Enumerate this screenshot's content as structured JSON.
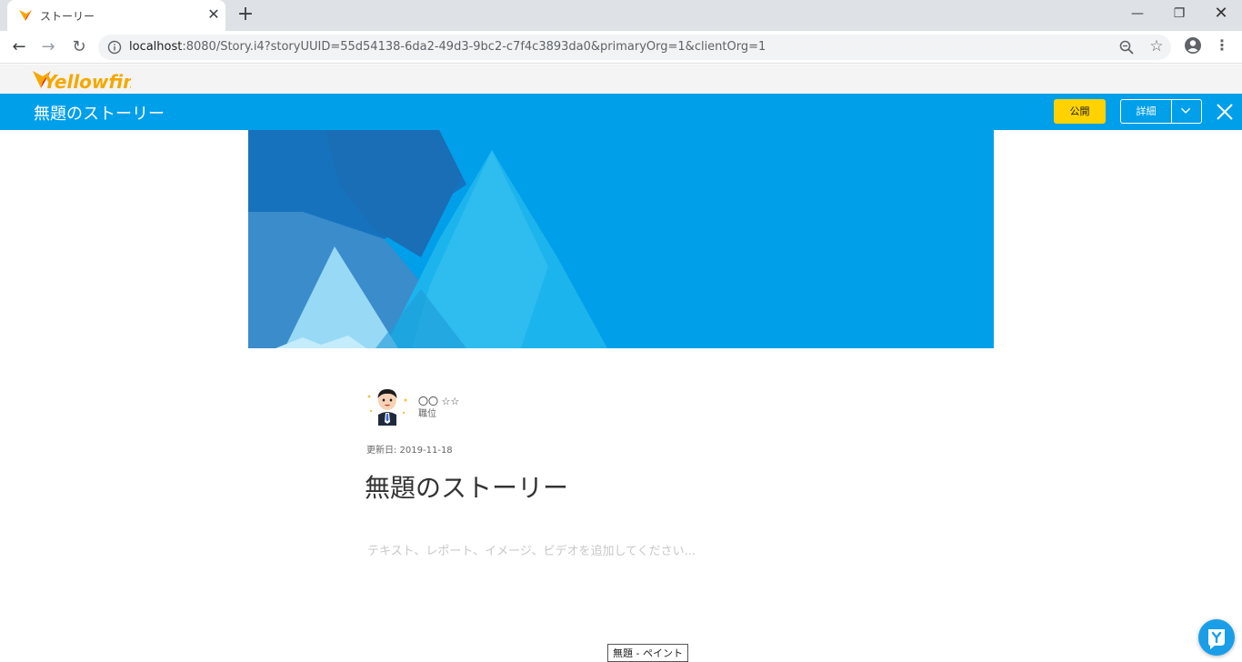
{
  "browser": {
    "tab_title": "ストーリー",
    "tab_close": "✕",
    "new_tab": "+",
    "window_min": "—",
    "window_max": "❐",
    "window_close": "✕",
    "back": "←",
    "forward": "→",
    "reload": "↻",
    "url_host": "localhost",
    "url_rest": ":8080/Story.i4?storyUUID=55d54138-6da2-49d3-9bc2-c7f4c3893da0&primaryOrg=1&clientOrg=1",
    "star": "☆",
    "menu": "⋮"
  },
  "app": {
    "logo_text": "Yellowfin",
    "header_title": "無題のストーリー",
    "publish_label": "公開",
    "details_label": "詳細"
  },
  "story": {
    "author_name": "〇〇 ☆☆",
    "author_role": "職位",
    "updated": "更新日: 2019-11-18",
    "title": "無題のストーリー",
    "content_placeholder": "テキスト、レポート、イメージ、ビデオを追加してください..."
  },
  "taskbar": {
    "tooltip": "無題 - ペイント"
  },
  "colors": {
    "accent": "#009fea",
    "publish": "#ffd200",
    "tab_strip": "#dee1e6"
  },
  "icons": {
    "info": "info-icon",
    "zoom": "zoom-icon",
    "star": "star-icon",
    "profile": "profile-icon",
    "close": "close-icon",
    "chevron": "chevron-down-icon",
    "assistant": "assistant-icon"
  }
}
